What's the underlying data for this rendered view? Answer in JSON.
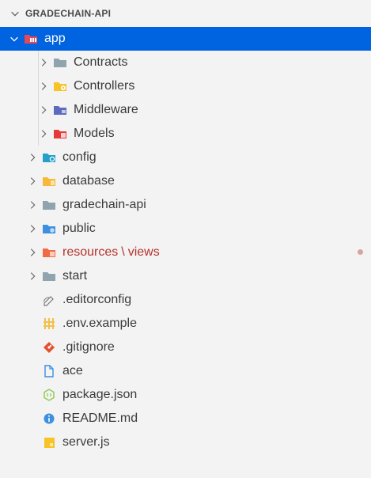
{
  "explorer": {
    "header": "GRADECHAIN-API",
    "items": [
      {
        "label": "app",
        "kind": "folder",
        "state": "expanded",
        "icon": "app-folder-icon",
        "selected": true
      },
      {
        "label": "Contracts",
        "kind": "folder",
        "state": "collapsed",
        "icon": "folder-icon",
        "depth": 1
      },
      {
        "label": "Controllers",
        "kind": "folder",
        "state": "collapsed",
        "icon": "controllers-folder-icon",
        "depth": 1
      },
      {
        "label": "Middleware",
        "kind": "folder",
        "state": "collapsed",
        "icon": "middleware-folder-icon",
        "depth": 1
      },
      {
        "label": "Models",
        "kind": "folder",
        "state": "collapsed",
        "icon": "models-folder-icon",
        "depth": 1
      },
      {
        "label": "config",
        "kind": "folder",
        "state": "collapsed",
        "icon": "config-folder-icon"
      },
      {
        "label": "database",
        "kind": "folder",
        "state": "collapsed",
        "icon": "database-folder-icon"
      },
      {
        "label": "gradechain-api",
        "kind": "folder",
        "state": "collapsed",
        "icon": "folder-icon"
      },
      {
        "label": "public",
        "kind": "folder",
        "state": "collapsed",
        "icon": "public-folder-icon"
      },
      {
        "label_part1": "resources",
        "label_sep": "\\",
        "label_part2": "views",
        "kind": "folder",
        "state": "collapsed",
        "icon": "resources-folder-icon",
        "modified": true
      },
      {
        "label": "start",
        "kind": "folder",
        "state": "collapsed",
        "icon": "folder-icon"
      },
      {
        "label": ".editorconfig",
        "kind": "file",
        "icon": "editorconfig-icon"
      },
      {
        "label": ".env.example",
        "kind": "file",
        "icon": "env-file-icon"
      },
      {
        "label": ".gitignore",
        "kind": "file",
        "icon": "git-icon"
      },
      {
        "label": "ace",
        "kind": "file",
        "icon": "file-icon"
      },
      {
        "label": "package.json",
        "kind": "file",
        "icon": "nodejs-icon"
      },
      {
        "label": "README.md",
        "kind": "file",
        "icon": "info-icon"
      },
      {
        "label": "server.js",
        "kind": "file",
        "icon": "javascript-icon"
      }
    ]
  },
  "colors": {
    "background": "#f3f3f3",
    "selection": "#0063e0",
    "modified_text": "#b5332e",
    "modified_dot": "#d9a3a0"
  }
}
